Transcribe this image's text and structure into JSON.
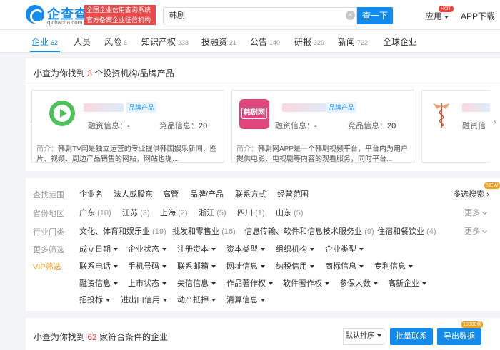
{
  "header": {
    "logo_text": "企查查",
    "logo_domain": "qichacha.com",
    "slogan": "全国企业信用查询系统 官方备案企业征信机构",
    "search_value": "韩剧",
    "search_button": "查一下",
    "nav_app": "应用",
    "hot_badge": "HOT",
    "app_download": "APP下载"
  },
  "tabs": [
    {
      "label": "企业",
      "count": "62"
    },
    {
      "label": "人员",
      "count": ""
    },
    {
      "label": "风险",
      "count": "6"
    },
    {
      "label": "知识产权",
      "count": "238"
    },
    {
      "label": "投融资",
      "count": "21"
    },
    {
      "label": "公告",
      "count": "140"
    },
    {
      "label": "研报",
      "count": "329"
    },
    {
      "label": "新闻",
      "count": "722"
    },
    {
      "label": "全球企业",
      "count": ""
    }
  ],
  "investor_section": {
    "prefix": "小查为你找到",
    "count": "3",
    "suffix": "个投资机构/品牌产品",
    "brands": [
      {
        "tag": "品牌产品",
        "funding_label": "融资信息：",
        "funding_value": "-",
        "competitor_label": "竞品信息：",
        "competitor_value": "20",
        "desc_key": "简介：",
        "desc": "韩剧TV网是独立运营的专业提供韩国娱乐新闻、图片、视频、周边产品销售的网站，网站也提..."
      },
      {
        "logo_text": "韩剧网",
        "tag": "品牌产品",
        "funding_label": "融资信息：",
        "funding_value": "-",
        "competitor_label": "竞品信息：",
        "competitor_value": "20",
        "desc_key": "简介：",
        "desc": "韩剧网APP是一个韩剧视频平台，平台内为用户提供电影、电视剧等内容的观看服务，同时平台..."
      },
      {
        "funding_label": "融资信"
      }
    ]
  },
  "filters": {
    "scope_label": "查找范围",
    "scope_items": [
      "企业名",
      "法人或股东",
      "高管",
      "品牌/产品",
      "联系方式",
      "经营范围"
    ],
    "multi_search": "多选搜索",
    "new_badge": "NEW",
    "region_label": "省份地区",
    "regions": [
      {
        "name": "广东",
        "n": "(10)"
      },
      {
        "name": "江苏",
        "n": "(3)"
      },
      {
        "name": "上海",
        "n": "(2)"
      },
      {
        "name": "浙江",
        "n": "(5)"
      },
      {
        "name": "四川",
        "n": "(1)"
      },
      {
        "name": "山东",
        "n": "(5)"
      }
    ],
    "more": "更多",
    "industry_label": "行业门类",
    "industries": [
      {
        "name": "文化、体育和娱乐业",
        "n": "(19)"
      },
      {
        "name": "批发和零售业",
        "n": "(16)"
      },
      {
        "name": "信息传输、软件和信息技术服务业",
        "n": "(9)"
      },
      {
        "name": "住宿和餐饮业",
        "n": "(4)"
      }
    ],
    "more_filters_label": "更多筛选",
    "more_filters_row": [
      "成立日期",
      "企业状态",
      "注册资本",
      "资本类型",
      "组织机构",
      "企业类型"
    ],
    "vip_label": "VIP筛选",
    "vip_row1": [
      "联系电话",
      "手机号码",
      "联系邮箱",
      "网址信息",
      "纳税信用",
      "商标信息",
      "专利信息"
    ],
    "vip_row2": [
      "融资信息",
      "上市状态",
      "失信信息",
      "作品著作权",
      "软件著作权",
      "参保人数",
      "高新企业"
    ],
    "vip_row3": [
      "招投标",
      "进出口信用",
      "动产抵押",
      "清算信息"
    ]
  },
  "results": {
    "prefix": "小查为你找到",
    "count": "62",
    "suffix": "家符合条件的企业",
    "sort": "默认排序",
    "batch_contact": "批量联系",
    "export": "导出数据",
    "export_badge": "10000条"
  },
  "colors": {
    "accent": "#128bed",
    "red": "#f04134",
    "vip": "#f0a020"
  }
}
